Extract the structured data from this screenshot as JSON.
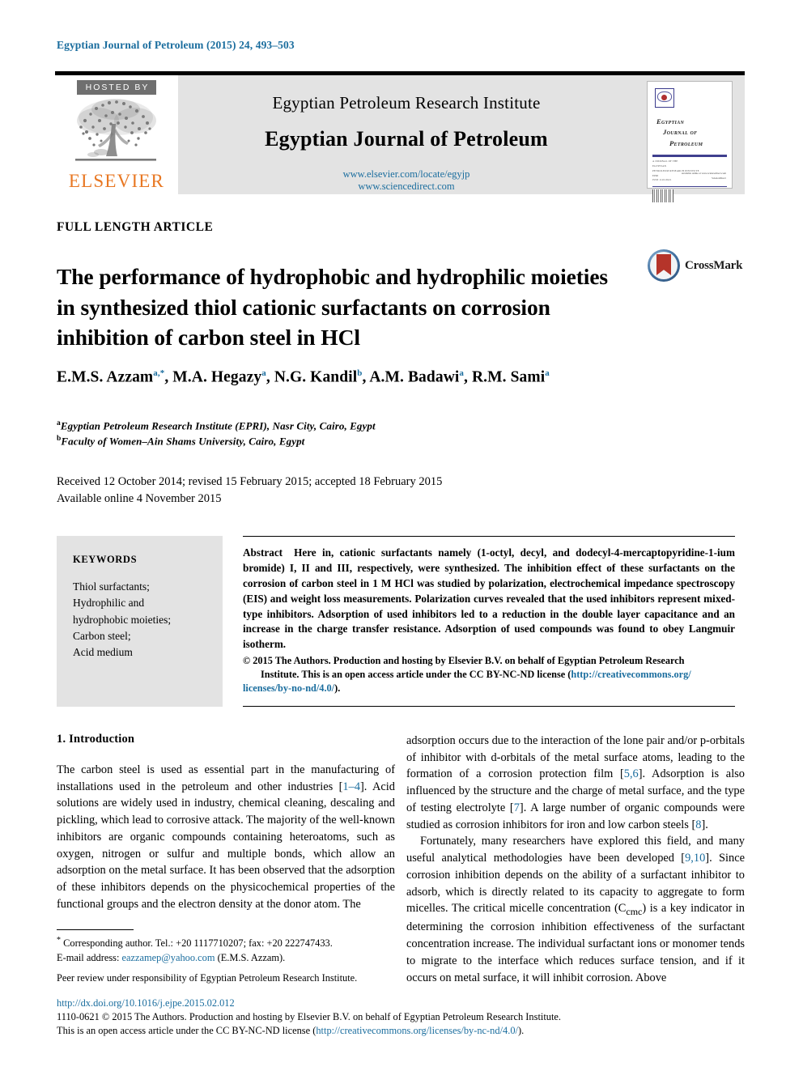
{
  "running_head": "Egyptian Journal of Petroleum (2015) 24, 493–503",
  "masthead": {
    "hosted_by": "HOSTED BY",
    "elsevier_wordmark": "ELSEVIER",
    "publisher": "Egyptian Petroleum Research Institute",
    "journal_title": "Egyptian Journal of Petroleum",
    "url_locate": "www.elsevier.com/locate/egyjp",
    "url_sciencedirect": "www.sciencedirect.com",
    "cover": {
      "title_line1": "Egyptian",
      "title_line2": "Journal of",
      "title_line3": "Petroleum",
      "meta_line1": "A JOURNAL OF THE",
      "meta_line2": "EGYPTIAN",
      "meta_line3": "PETROLEUM RESEARCH INSTITUTE",
      "meta_line4": "EPRI",
      "meta_line5": "ISSN 1110-0621",
      "sd_line1": "Available online at www.sciencedirect.com",
      "sd_line2": "ScienceDirect"
    }
  },
  "article_type": "FULL LENGTH ARTICLE",
  "title": "The performance of hydrophobic and hydrophilic moieties in synthesized thiol cationic surfactants on corrosion inhibition of carbon steel in HCl",
  "crossmark_label": "CrossMark",
  "authors": [
    {
      "name": "E.M.S. Azzam",
      "marks": "a,*"
    },
    {
      "name": "M.A. Hegazy",
      "marks": "a"
    },
    {
      "name": "N.G. Kandil",
      "marks": "b"
    },
    {
      "name": "A.M. Badawi",
      "marks": "a"
    },
    {
      "name": "R.M. Sami",
      "marks": "a"
    }
  ],
  "affiliations": [
    {
      "mark": "a",
      "text": "Egyptian Petroleum Research Institute (EPRI), Nasr City, Cairo, Egypt"
    },
    {
      "mark": "b",
      "text": "Faculty of Women–Ain Shams University, Cairo, Egypt"
    }
  ],
  "history": {
    "line1": "Received 12 October 2014; revised 15 February 2015; accepted 18 February 2015",
    "line2": "Available online 4 November 2015"
  },
  "keywords": {
    "heading": "KEYWORDS",
    "items": [
      "Thiol surfactants;",
      "Hydrophilic and",
      "hydrophobic moieties;",
      "Carbon steel;",
      "Acid medium"
    ]
  },
  "abstract": {
    "label": "Abstract",
    "text": "Here in, cationic surfactants namely (1-octyl, decyl, and dodecyl-4-mercaptopyridine-1-ium bromide) I, II and III, respectively, were synthesized. The inhibition effect of these surfactants on the corrosion of carbon steel in 1 M HCl was studied by polarization, electrochemical impedance spectroscopy (EIS) and weight loss measurements. Polarization curves revealed that the used inhibitors represent mixed-type inhibitors. Adsorption of used inhibitors led to a reduction in the double layer capacitance and an increase in the charge transfer resistance. Adsorption of used compounds was found to obey Langmuir isotherm.",
    "copyright_line1": "© 2015 The Authors. Production and hosting by Elsevier B.V. on behalf of Egyptian Petroleum Research",
    "copyright_line2": "Institute. This is an open access article under the CC BY-NC-ND license (",
    "copyright_link1": "http://creativecommons.org/",
    "copyright_link2": "licenses/by-no-nd/4.0/",
    "copyright_line3": ")."
  },
  "body": {
    "intro_heading": "1. Introduction",
    "left_para1_a": "The carbon steel is used as essential part in the manufacturing of installations used in the petroleum and other industries [",
    "left_para1_cite": "1–4",
    "left_para1_b": "]. Acid solutions are widely used in industry, chemical cleaning, descaling and pickling, which lead to corrosive attack. The majority of the well-known inhibitors are organic compounds containing heteroatoms, such as oxygen, nitrogen or sulfur and multiple bonds, which allow an adsorption on the metal surface. It has been observed that the adsorption of these inhibitors depends on the physicochemical properties of the functional groups and the electron density at the donor atom. The",
    "right_para1_a": "adsorption occurs due to the interaction of the lone pair and/or p-orbitals of inhibitor with d-orbitals of the metal surface atoms, leading to the formation of a corrosion protection film [",
    "right_para1_cite1": "5,6",
    "right_para1_b": "]. Adsorption is also influenced by the structure and the charge of metal surface, and the type of testing electrolyte [",
    "right_para1_cite2": "7",
    "right_para1_c": "]. A large number of organic compounds were studied as corrosion inhibitors for iron and low carbon steels [",
    "right_para1_cite3": "8",
    "right_para1_d": "].",
    "right_para2_a": "Fortunately, many researchers have explored this field, and many useful analytical methodologies have been developed [",
    "right_para2_cite": "9,10",
    "right_para2_b": "]. Since corrosion inhibition depends on the ability of a surfactant inhibitor to adsorb, which is directly related to its capacity to aggregate to form micelles. The critical micelle concentration (C",
    "right_para2_sub": "cmc",
    "right_para2_c": ") is a key indicator in determining the corrosion inhibition effectiveness of the surfactant concentration increase. The individual surfactant ions or monomer tends to migrate to the interface which reduces surface tension, and if it occurs on metal surface, it will inhibit corrosion. Above"
  },
  "footnote": {
    "corresponding_a": "Corresponding author. Tel.: +20 1117710207; fax: +20 222747433.",
    "email_label": "E-mail address:",
    "email": "eazzamep@yahoo.com",
    "email_suffix": "(E.M.S. Azzam).",
    "peer_review": "Peer review under responsibility of Egyptian Petroleum Research Institute."
  },
  "page_footer": {
    "doi": "http://dx.doi.org/10.1016/j.ejpe.2015.02.012",
    "line1": "1110-0621 © 2015 The Authors. Production and hosting by Elsevier B.V. on behalf of Egyptian Petroleum Research Institute.",
    "line2_a": "This is an open access article under the CC BY-NC-ND license (",
    "line2_link": "http://creativecommons.org/licenses/by-nc-nd/4.0/",
    "line2_b": ")."
  }
}
